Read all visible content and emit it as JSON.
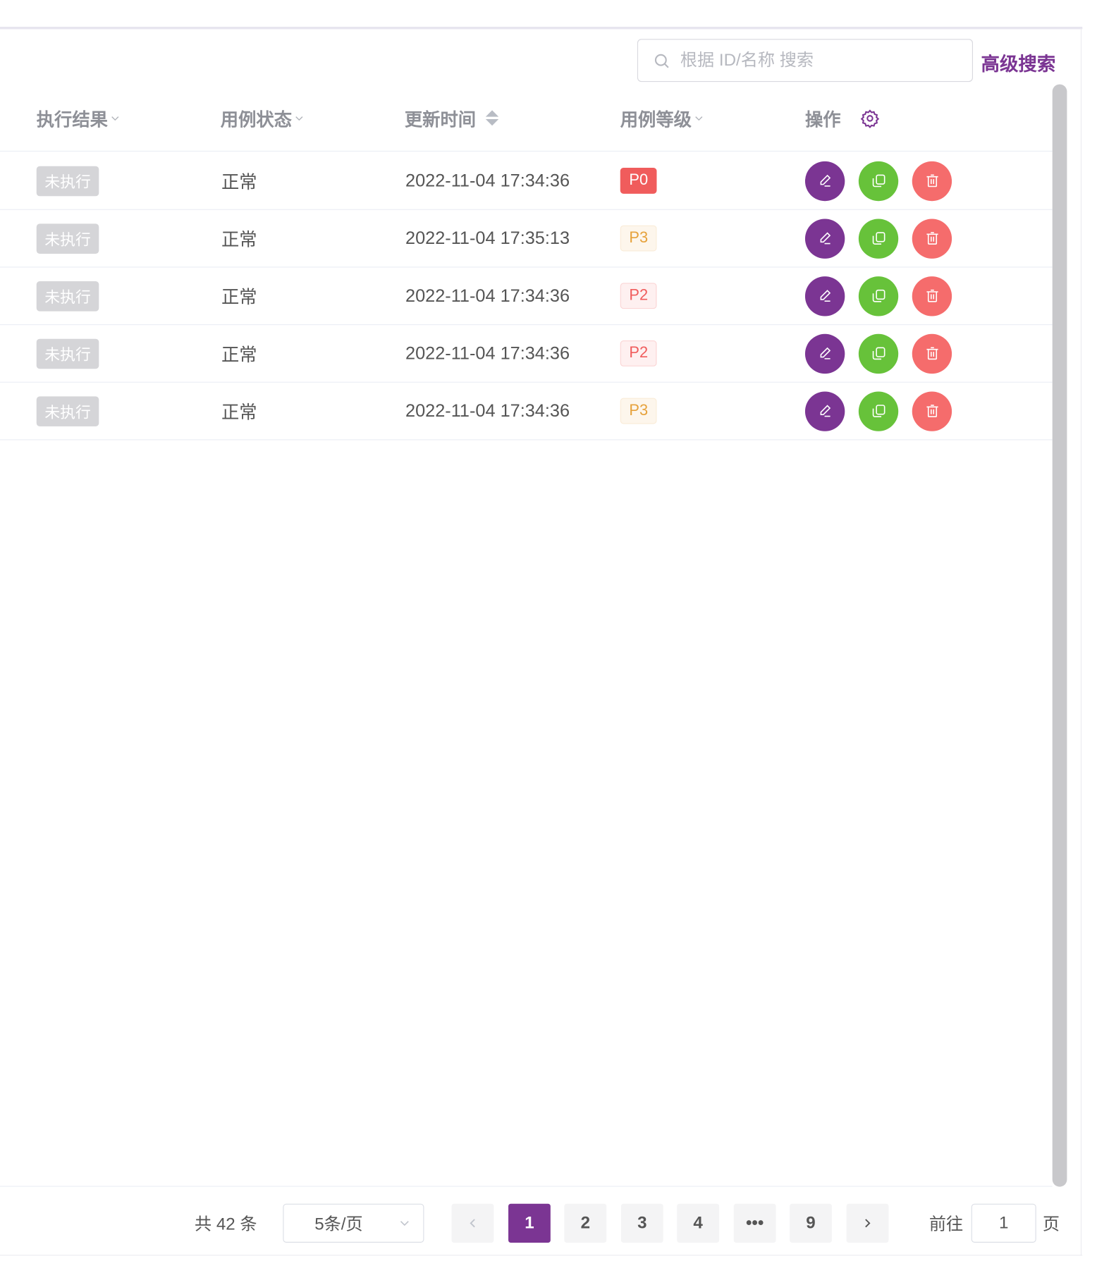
{
  "search": {
    "placeholder": "根据 ID/名称 搜索",
    "value": "",
    "advanced_label": "高级搜索"
  },
  "columns": {
    "result": "执行结果",
    "status": "用例状态",
    "updated": "更新时间",
    "level": "用例等级",
    "actions": "操作"
  },
  "rows": [
    {
      "result": "未执行",
      "status": "正常",
      "updated": "2022-11-04 17:34:36",
      "level": "P0"
    },
    {
      "result": "未执行",
      "status": "正常",
      "updated": "2022-11-04 17:35:13",
      "level": "P3"
    },
    {
      "result": "未执行",
      "status": "正常",
      "updated": "2022-11-04 17:34:36",
      "level": "P2"
    },
    {
      "result": "未执行",
      "status": "正常",
      "updated": "2022-11-04 17:34:36",
      "level": "P2"
    },
    {
      "result": "未执行",
      "status": "正常",
      "updated": "2022-11-04 17:34:36",
      "level": "P3"
    }
  ],
  "actions": {
    "edit_icon": "edit-icon",
    "copy_icon": "copy-icon",
    "delete_icon": "delete-icon"
  },
  "colors": {
    "accent": "#7b3593",
    "success": "#67c23a",
    "danger": "#f56c6c",
    "warning": "#e6a23c"
  },
  "pagination": {
    "total_label": "共 42 条",
    "page_size": "5条/页",
    "pages": [
      "1",
      "2",
      "3",
      "4",
      "•••",
      "9"
    ],
    "current_page": "1",
    "goto_prefix": "前往",
    "goto_value": "1",
    "goto_suffix": "页"
  }
}
